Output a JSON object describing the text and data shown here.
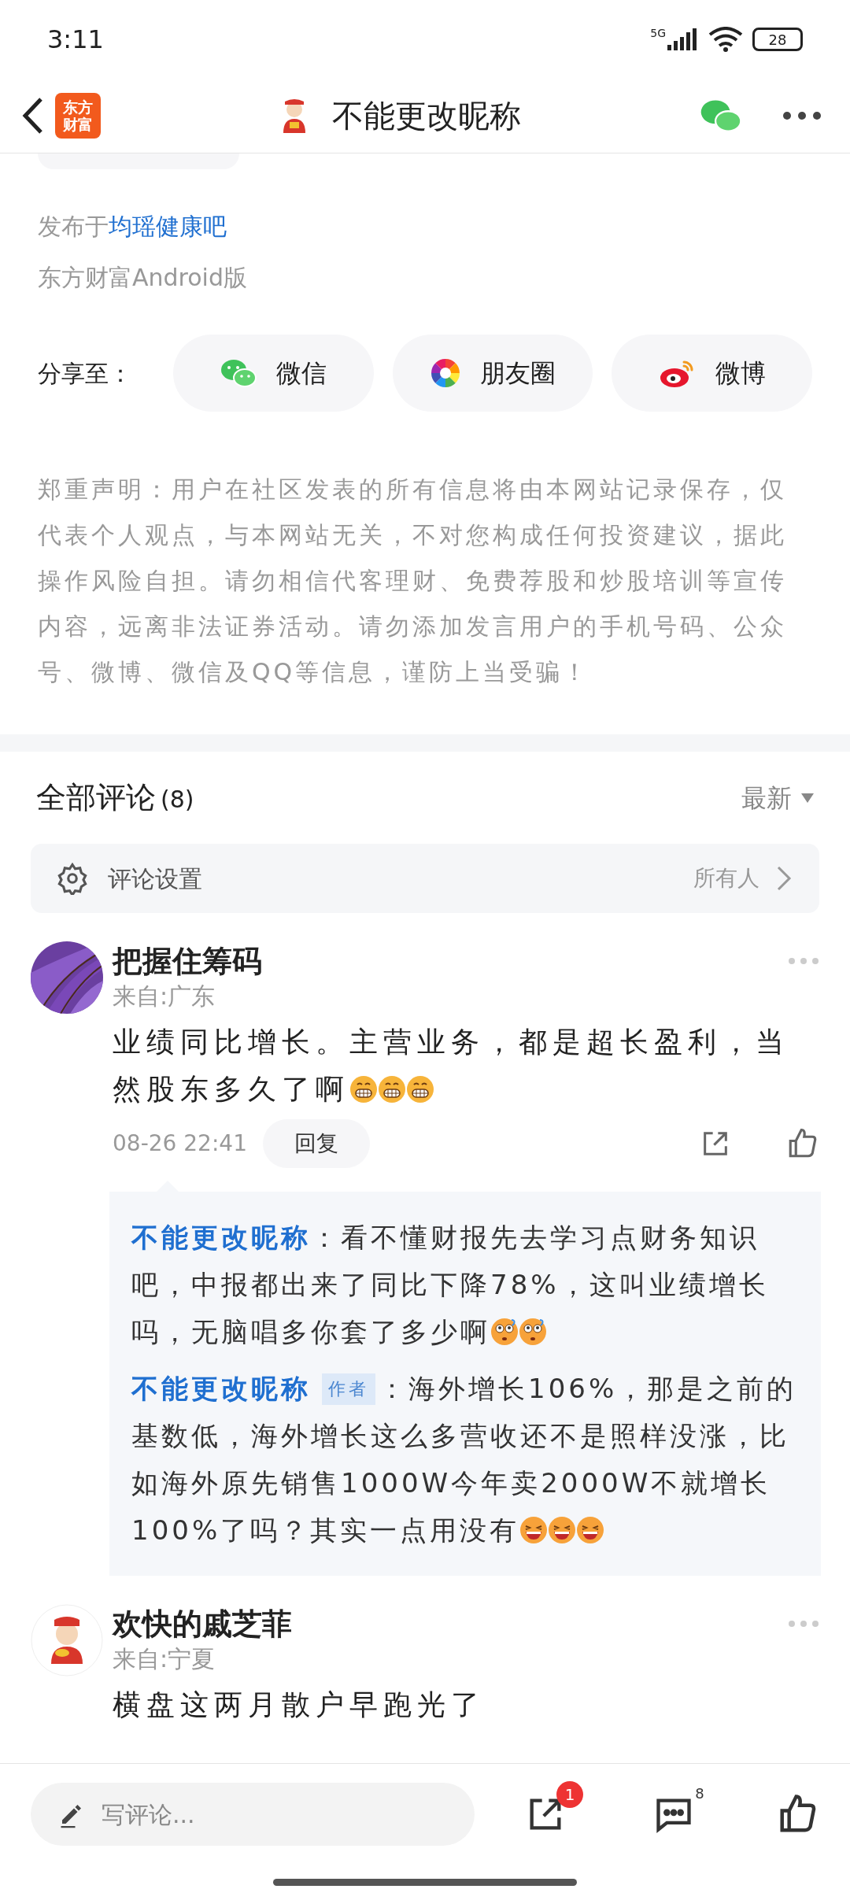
{
  "status_bar": {
    "time": "3:11",
    "network": "5G",
    "battery": "28"
  },
  "header": {
    "logo": "东方财富",
    "title": "不能更改昵称"
  },
  "post_meta": {
    "published_prefix": "发布于",
    "forum": "均瑶健康吧",
    "source": "东方财富Android版"
  },
  "share": {
    "label": "分享至：",
    "targets": [
      {
        "kind": "wechat",
        "label": "微信"
      },
      {
        "kind": "moments",
        "label": "朋友圈"
      },
      {
        "kind": "weibo",
        "label": "微博"
      }
    ]
  },
  "disclaimer": "郑重声明：用户在社区发表的所有信息将由本网站记录保存，仅代表个人观点，与本网站无关，不对您构成任何投资建议，据此操作风险自担。请勿相信代客理财、免费荐股和炒股培训等宣传内容，远离非法证券活动。请勿添加发言用户的手机号码、公众号、微博、微信及QQ等信息，谨防上当受骗！",
  "comments_header": {
    "title": "全部评论",
    "count": "(8)",
    "sort": "最新"
  },
  "comment_settings": {
    "label": "评论设置",
    "value": "所有人"
  },
  "comments": [
    {
      "avatar": {
        "kind": "picture"
      },
      "name": "把握住筹码",
      "location": "来自:广东",
      "text": "业绩同比增长。主营业务，都是超长盈利，当然股东多久了啊",
      "emojis": [
        {
          "kind": "grin"
        },
        {
          "kind": "grin"
        },
        {
          "kind": "grin"
        }
      ],
      "time": "08-26 22:41",
      "reply_button": "回复",
      "replies": [
        {
          "name": "不能更改昵称",
          "text": "：看不懂财报先去学习点财务知识吧，中报都出来了同比下降78%，这叫业绩增长吗，无脑唱多你套了多少啊",
          "emojis": [
            {
              "kind": "puzzled"
            },
            {
              "kind": "puzzled"
            }
          ]
        },
        {
          "name": "不能更改昵称",
          "badge": "作者",
          "text": "：海外增长106%，那是之前的基数低，海外增长这么多营收还不是照样没涨，比如海外原先销售1000W今年卖2000W不就增长100%了吗？其实一点用没有",
          "emojis": [
            {
              "kind": "laugh"
            },
            {
              "kind": "laugh"
            },
            {
              "kind": "laugh"
            }
          ]
        }
      ]
    },
    {
      "avatar": {
        "kind": "figure"
      },
      "name": "欢快的戚芝菲",
      "location": "来自:宁夏",
      "text": "横盘这两月散户早跑光了"
    }
  ],
  "bottom_bar": {
    "placeholder": "写评论...",
    "share_badge": "1",
    "comment_count": "8"
  }
}
